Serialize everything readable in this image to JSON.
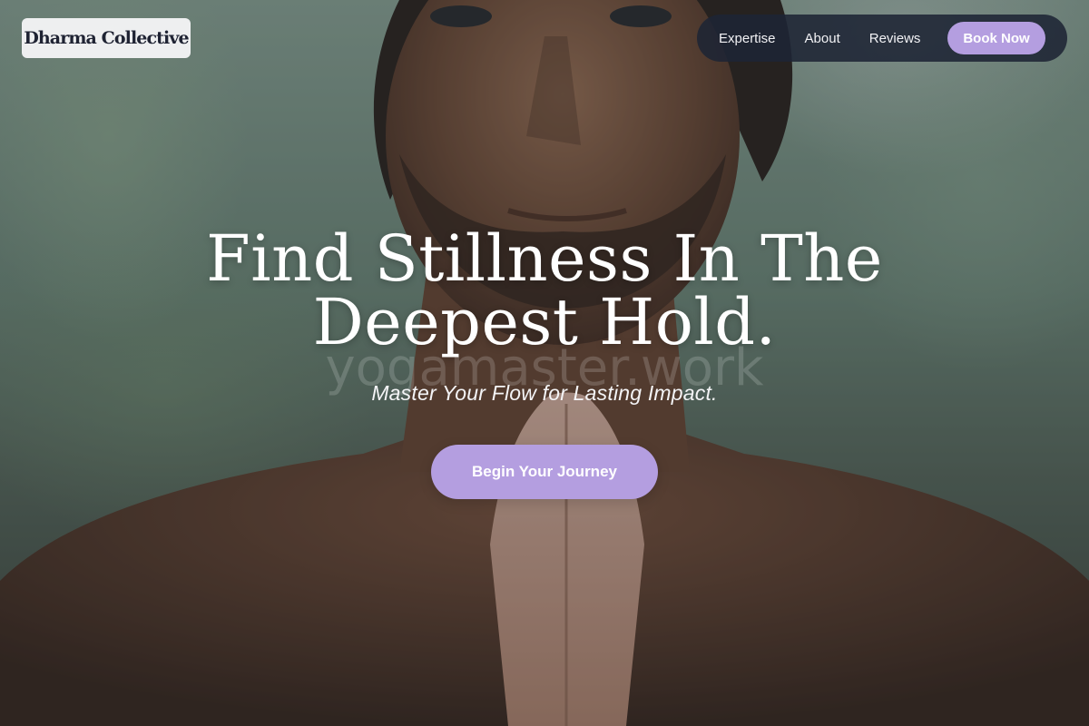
{
  "brand": {
    "name": "Dharma Collective"
  },
  "nav": {
    "links": [
      {
        "label": "Expertise"
      },
      {
        "label": "About"
      },
      {
        "label": "Reviews"
      }
    ],
    "cta_label": "Book Now"
  },
  "hero": {
    "headline_line1": "Find Stillness In The",
    "headline_line2": "Deepest Hold.",
    "watermark": "yogamaster.work",
    "subheadline": "Master Your Flow for Lasting Impact.",
    "cta_label": "Begin Your Journey",
    "background_image": "man-prayer-hands-photo"
  },
  "colors": {
    "accent": "#b49ee0",
    "nav_background": "#1e2434",
    "logo_background": "#f5f5f7",
    "text_light": "#ffffff"
  }
}
